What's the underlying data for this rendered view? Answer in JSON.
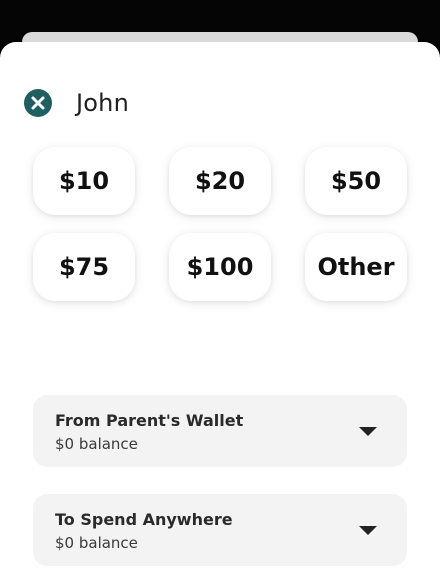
{
  "colors": {
    "accent": "#1f5f62",
    "card_bg": "#f3f3f3"
  },
  "recipient": {
    "name": "John",
    "close_icon": "close-icon"
  },
  "amounts": [
    "$10",
    "$20",
    "$50",
    "$75",
    "$100",
    "Other"
  ],
  "from_wallet": {
    "title": "From Parent's Wallet",
    "balance": "$0 balance"
  },
  "to_wallet": {
    "title": "To Spend Anywhere",
    "balance": "$0 balance"
  }
}
